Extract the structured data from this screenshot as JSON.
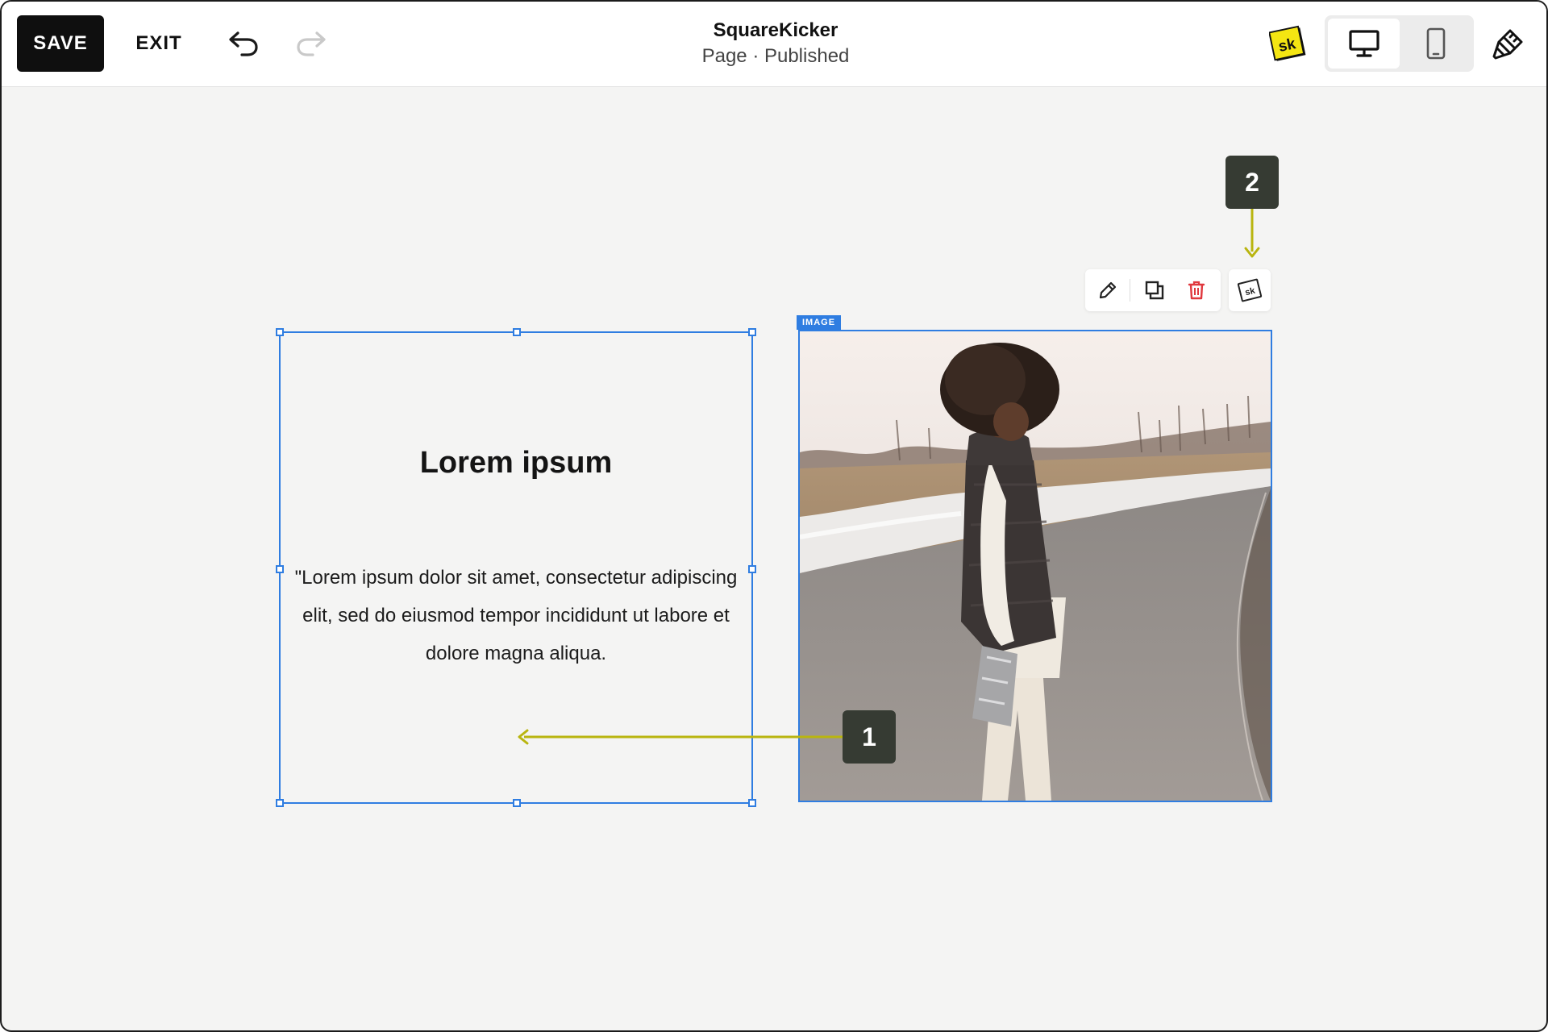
{
  "toolbar": {
    "save_label": "SAVE",
    "exit_label": "EXIT",
    "site_name": "SquareKicker",
    "page_status": "Page · Published",
    "logo_text": "sk"
  },
  "icons": {
    "undo": "undo-icon",
    "redo": "redo-icon",
    "desktop": "desktop-icon",
    "mobile": "mobile-icon",
    "brush": "paint-brush-icon",
    "edit": "pencil-icon",
    "duplicate": "duplicate-icon",
    "delete": "trash-icon",
    "squarekicker": "squarekicker-icon"
  },
  "text_block": {
    "heading": "Lorem ipsum",
    "body": "\"Lorem ipsum dolor sit amet, consectetur adipiscing elit, sed do eiusmod tempor incididunt ut labore et dolore magna aliqua."
  },
  "image_block": {
    "tag": "IMAGE"
  },
  "callouts": {
    "one": "1",
    "two": "2"
  },
  "colors": {
    "selection": "#2f7de1",
    "arrow": "#b9b50f",
    "callout_bg": "#363b33",
    "delete": "#e0383e",
    "logo_bg": "#f4e512"
  }
}
